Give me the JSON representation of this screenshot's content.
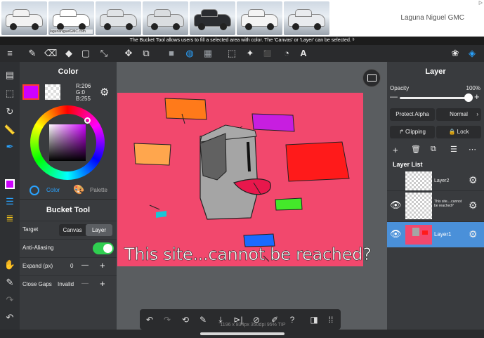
{
  "ad": {
    "brand": "Laguna Niguel GMC",
    "close": "ᐅ",
    "captions": [
      "",
      "lagunaniguelGMC.com",
      "",
      "",
      "",
      "",
      ""
    ],
    "car_colors": [
      "#f2f2f2",
      "#ffffff",
      "#e0e3e6",
      "#dadde0",
      "#2a2c30",
      "#f4f4f4",
      "#e9ebee"
    ]
  },
  "tooltip": "The Bucket Tool allows users to fill a selected area with color. The 'Canvas' or 'Layer' can be selected. ᵇ",
  "toolbar": {
    "menu": "≡",
    "pen": "✎",
    "eraser": "⌫",
    "smudge": "◆",
    "select_rect": "▢",
    "lasso": "⤡",
    "move": "✥",
    "transform": "⧉",
    "fill_color": "■",
    "bucket": "◍",
    "gradient": "▦",
    "select_fill": "⬚",
    "wand": "✦",
    "text_select": "⬛",
    "shape": "◔",
    "text": "A",
    "materials": "❀",
    "layers": "◈"
  },
  "color": {
    "title": "Color",
    "r": "R:206",
    "g": "G:0",
    "b": "B:255",
    "primary": "#ce00ff",
    "tab_color": "Color",
    "tab_palette": "Palette"
  },
  "bucket": {
    "title": "Bucket Tool",
    "target_label": "Target",
    "canvas_opt": "Canvas",
    "layer_opt": "Layer",
    "antialias_label": "Anti-Aliasing",
    "antialias_on": true,
    "expand_label": "Expand (px)",
    "expand_value": "0",
    "gaps_label": "Close Gaps",
    "gaps_value": "Invalid",
    "minus": "—",
    "plus": "+"
  },
  "canvas": {
    "caption": "This site...cannot be reached?",
    "shapes": [
      {
        "name": "orange-top",
        "color": "#ff7a1a"
      },
      {
        "name": "purple",
        "color": "#c71ee0"
      },
      {
        "name": "orange-left",
        "color": "#ffa64d"
      },
      {
        "name": "red-right",
        "color": "#ff1a1a"
      },
      {
        "name": "green",
        "color": "#44e82a"
      },
      {
        "name": "blue",
        "color": "#1a6bff"
      },
      {
        "name": "cyan",
        "color": "#19c6d6"
      }
    ]
  },
  "layer": {
    "title": "Layer",
    "opacity_label": "Opacity",
    "opacity_value": "100%",
    "opacity_fraction": 1.0,
    "protect_alpha": "Protect Alpha",
    "blend_mode": "Normal",
    "clipping": "Clipping",
    "lock": "Lock",
    "list_title": "Layer List",
    "layers": [
      {
        "name": "Layer2",
        "visible": false,
        "selected": false
      },
      {
        "name": "This site....cannot be reached?",
        "visible": true,
        "selected": false
      },
      {
        "name": "Layer1",
        "visible": true,
        "selected": true
      }
    ]
  },
  "status": "1196 x 834px 350dpi 95% TIP"
}
